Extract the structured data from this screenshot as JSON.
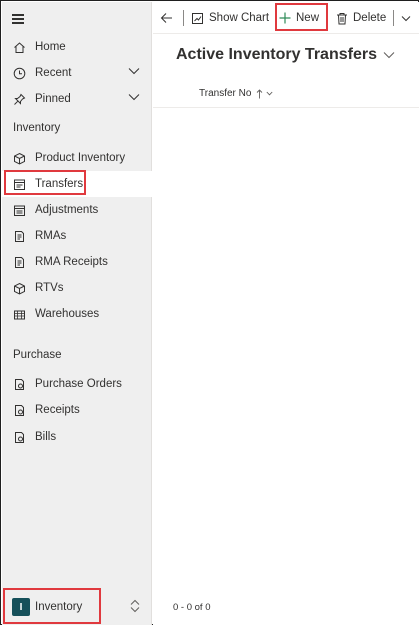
{
  "sidebar": {
    "top_items": [
      {
        "label": "Home",
        "icon": "home-icon"
      },
      {
        "label": "Recent",
        "icon": "clock-icon"
      },
      {
        "label": "Pinned",
        "icon": "pin-icon"
      }
    ],
    "sections": [
      {
        "title": "Inventory",
        "items": [
          {
            "label": "Product Inventory",
            "icon": "box-icon"
          },
          {
            "label": "Transfers",
            "icon": "transfer-icon",
            "selected": true
          },
          {
            "label": "Adjustments",
            "icon": "adjustments-icon"
          },
          {
            "label": "RMAs",
            "icon": "document-icon"
          },
          {
            "label": "RMA Receipts",
            "icon": "receipt-icon"
          },
          {
            "label": "RTVs",
            "icon": "box-return-icon"
          },
          {
            "label": "Warehouses",
            "icon": "warehouse-icon"
          }
        ]
      },
      {
        "title": "Purchase",
        "items": [
          {
            "label": "Purchase Orders",
            "icon": "purchase-order-icon"
          },
          {
            "label": "Receipts",
            "icon": "receipt-icon"
          },
          {
            "label": "Bills",
            "icon": "bill-icon"
          }
        ]
      }
    ],
    "area_switcher": {
      "badge": "I",
      "label": "Inventory"
    }
  },
  "command_bar": {
    "show_chart_label": "Show Chart",
    "new_label": "New",
    "delete_label": "Delete"
  },
  "view": {
    "title": "Active Inventory Transfers",
    "columns": [
      {
        "label": "Transfer No",
        "sort": "ascending"
      }
    ],
    "rows": [],
    "record_count": "0 - 0 of 0"
  },
  "colors": {
    "highlight": "#e0393e",
    "sidebar_bg": "#efefef",
    "badge_bg": "#16505a",
    "new_icon": "#2e8b57"
  }
}
